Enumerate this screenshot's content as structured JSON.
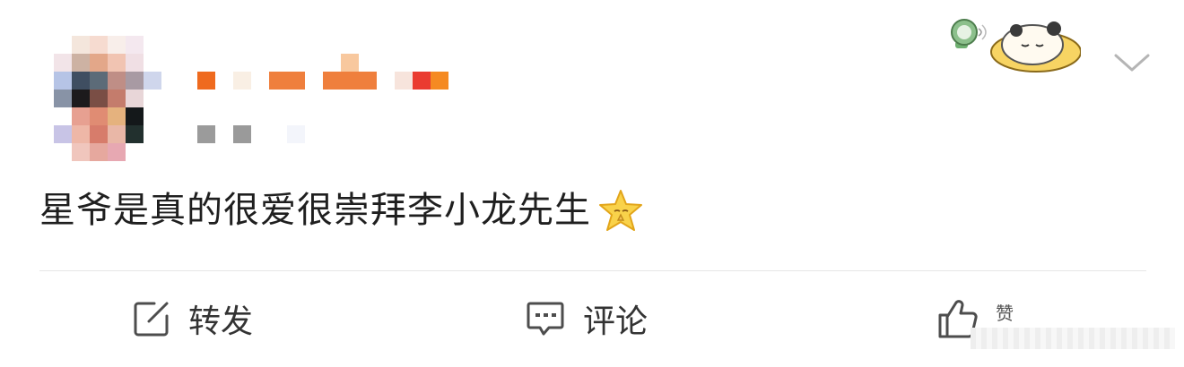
{
  "post": {
    "text": "星爷是真的很爱很崇拜李小龙先生",
    "emoji": "star-praying-icon"
  },
  "actions": {
    "repost_label": "转发",
    "comment_label": "评论",
    "like_label": "赞"
  },
  "colors": {
    "name_accent": "#ef6a1e",
    "text": "#1f1f1f",
    "divider": "#e6e6e6"
  },
  "icons": {
    "repost": "edit-square-icon",
    "comment": "comment-icon",
    "like": "thumbs-up-icon",
    "more": "chevron-down-icon"
  }
}
